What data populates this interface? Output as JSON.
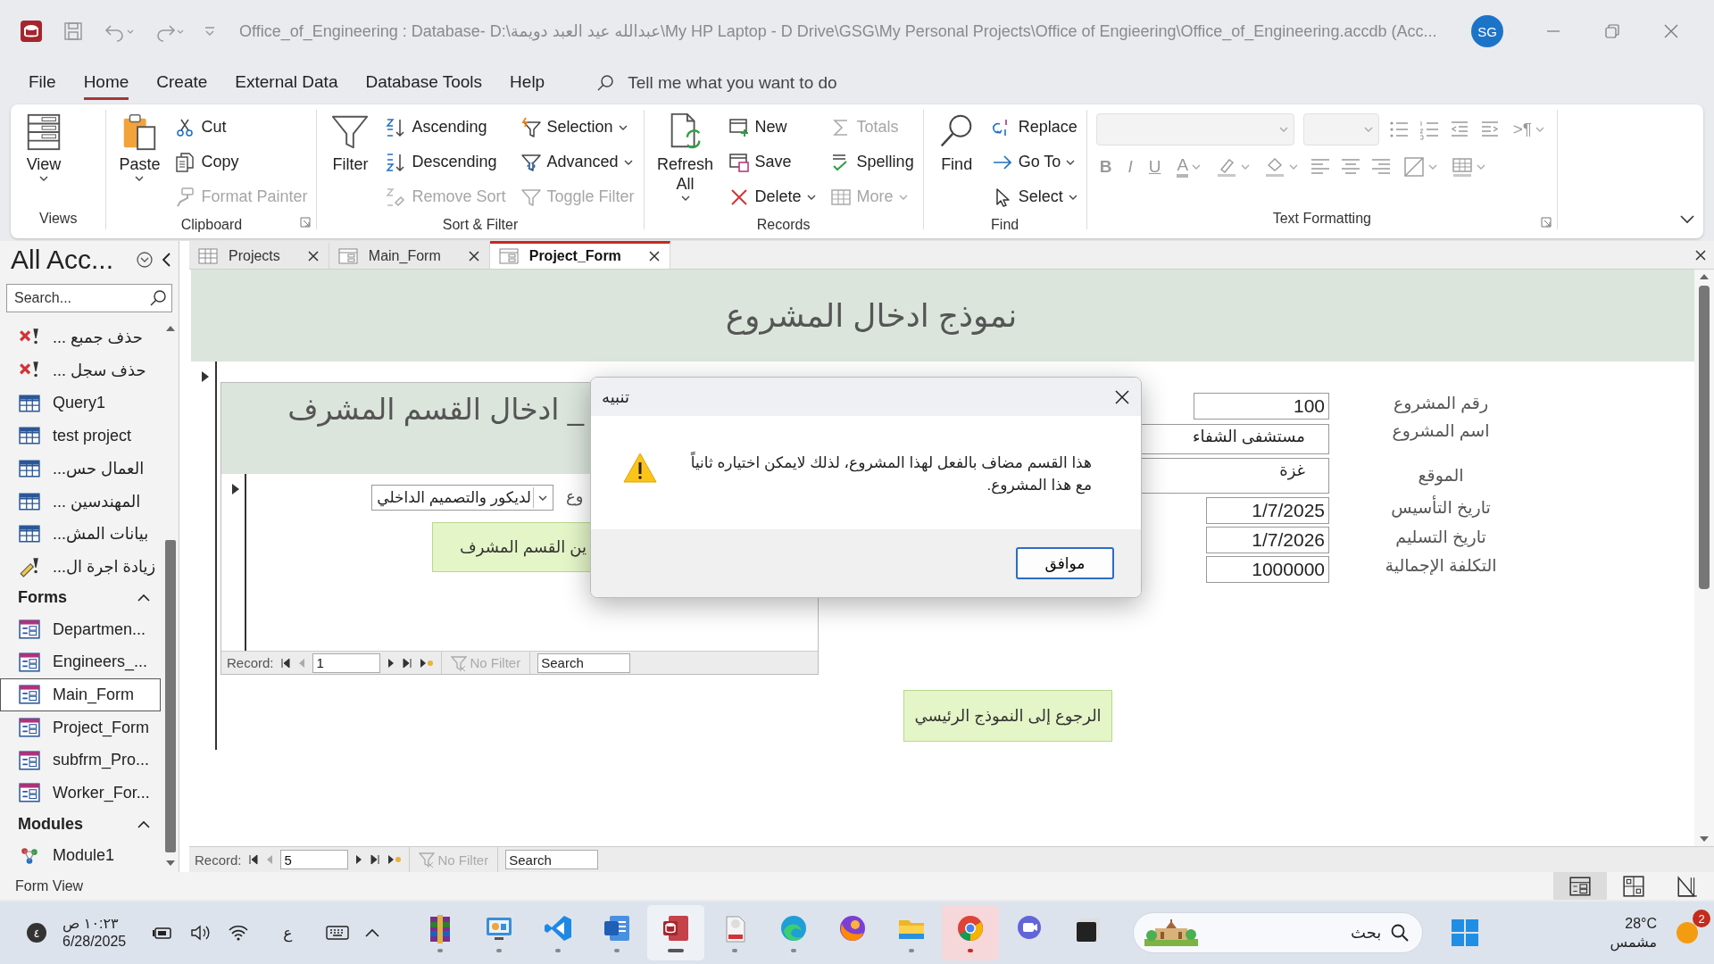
{
  "window": {
    "title": "Office_of_Engineering : Database- D:\\عبدالله عيد العبد دويمة\\My HP Laptop - D Drive\\GSG\\My Personal Projects\\Office of Engieering\\Office_of_Engineering.accdb (Acc...",
    "account": "SG"
  },
  "menu_tabs": [
    {
      "label": "File",
      "selected": false
    },
    {
      "label": "Home",
      "selected": true
    },
    {
      "label": "Create",
      "selected": false
    },
    {
      "label": "External Data",
      "selected": false
    },
    {
      "label": "Database Tools",
      "selected": false
    },
    {
      "label": "Help",
      "selected": false
    }
  ],
  "tell_me": {
    "placeholder": "Tell me what you want to do"
  },
  "ribbon_groups": [
    {
      "label": "Views",
      "kind": "buttons",
      "launcher": false,
      "items": [
        {
          "label": "View",
          "kind": "large",
          "disabled": false,
          "dropdown": true
        }
      ]
    },
    {
      "label": "Clipboard",
      "kind": "buttons",
      "launcher": true,
      "items": [
        {
          "label": "Paste",
          "kind": "large",
          "disabled": false,
          "dropdown": true
        },
        {
          "label": "Cut",
          "kind": "small",
          "disabled": false,
          "dropdown": false
        },
        {
          "label": "Copy",
          "kind": "small",
          "disabled": false,
          "dropdown": false
        },
        {
          "label": "Format Painter",
          "kind": "small",
          "disabled": true,
          "dropdown": false
        }
      ]
    },
    {
      "label": "Sort & Filter",
      "kind": "buttons",
      "launcher": false,
      "items": [
        {
          "label": "Filter",
          "kind": "large",
          "disabled": false,
          "dropdown": false
        },
        {
          "label": "Ascending",
          "kind": "small",
          "disabled": false,
          "dropdown": false
        },
        {
          "label": "Descending",
          "kind": "small",
          "disabled": false,
          "dropdown": false
        },
        {
          "label": "Remove Sort",
          "kind": "small",
          "disabled": true,
          "dropdown": false
        },
        {
          "label": "Selection",
          "kind": "small",
          "disabled": false,
          "dropdown": true
        },
        {
          "label": "Advanced",
          "kind": "small",
          "disabled": false,
          "dropdown": true
        },
        {
          "label": "Toggle Filter",
          "kind": "small",
          "disabled": true,
          "dropdown": false
        }
      ]
    },
    {
      "label": "Records",
      "kind": "buttons",
      "launcher": false,
      "items": [
        {
          "label": "Refresh All",
          "kind": "large",
          "disabled": false,
          "dropdown": true
        },
        {
          "label": "New",
          "kind": "small",
          "disabled": false,
          "dropdown": false
        },
        {
          "label": "Save",
          "kind": "small",
          "disabled": false,
          "dropdown": false
        },
        {
          "label": "Delete",
          "kind": "small",
          "disabled": false,
          "dropdown": true
        },
        {
          "label": "Totals",
          "kind": "small",
          "disabled": true,
          "dropdown": false
        },
        {
          "label": "Spelling",
          "kind": "small",
          "disabled": false,
          "dropdown": false
        },
        {
          "label": "More",
          "kind": "small",
          "disabled": true,
          "dropdown": true
        }
      ]
    },
    {
      "label": "Find",
      "kind": "buttons",
      "launcher": false,
      "items": [
        {
          "label": "Find",
          "kind": "large",
          "disabled": false,
          "dropdown": false
        },
        {
          "label": "Replace",
          "kind": "small",
          "disabled": false,
          "dropdown": false
        },
        {
          "label": "Go To",
          "kind": "small",
          "disabled": false,
          "dropdown": true
        },
        {
          "label": "Select",
          "kind": "small",
          "disabled": false,
          "dropdown": true
        }
      ]
    },
    {
      "label": "Text Formatting",
      "kind": "format",
      "launcher": true,
      "rows": [
        [
          {
            "kind": "combo",
            "disabled": true
          },
          {
            "kind": "combo",
            "disabled": true
          },
          {
            "kind": "icon",
            "disabled": true,
            "dropdown": false
          },
          {
            "kind": "icon",
            "disabled": true,
            "dropdown": false
          },
          {
            "kind": "icon",
            "disabled": true,
            "dropdown": false
          },
          {
            "kind": "icon",
            "disabled": true,
            "dropdown": false
          },
          {
            "kind": "glyph",
            "label": ">¶",
            "disabled": true,
            "dropdown": true
          }
        ],
        [
          {
            "kind": "glyph",
            "label": "B",
            "disabled": true,
            "dropdown": false
          },
          {
            "kind": "glyph",
            "label": "I",
            "disabled": true,
            "dropdown": false
          },
          {
            "kind": "glyph",
            "label": "U",
            "disabled": true,
            "dropdown": false
          },
          {
            "kind": "glyph",
            "label": "A",
            "disabled": true,
            "dropdown": true
          },
          {
            "kind": "icon",
            "disabled": true,
            "dropdown": true
          },
          {
            "kind": "icon",
            "disabled": true,
            "dropdown": true
          },
          {
            "kind": "icon",
            "disabled": true,
            "dropdown": false
          },
          {
            "kind": "icon",
            "disabled": true,
            "dropdown": false
          },
          {
            "kind": "icon",
            "disabled": true,
            "dropdown": false
          },
          {
            "kind": "icon",
            "disabled": true,
            "dropdown": true
          },
          {
            "kind": "icon",
            "disabled": true,
            "dropdown": true
          }
        ]
      ]
    }
  ],
  "nav_pane": {
    "title": "All Acc...",
    "search": {
      "placeholder": "Search..."
    },
    "groups": [
      {
        "items": [
          {
            "label": "حذف جمبع ...",
            "kind": "delete-query",
            "selected": false
          },
          {
            "label": "حذف سجل ...",
            "kind": "delete-query",
            "selected": false
          },
          {
            "label": "Query1",
            "kind": "select-query",
            "selected": false
          },
          {
            "label": "test project",
            "kind": "select-query",
            "selected": false
          },
          {
            "label": "العمال حس...",
            "kind": "select-query",
            "selected": false
          },
          {
            "label": "المهندسين ...",
            "kind": "select-query",
            "selected": false
          },
          {
            "label": "بيانات المش...",
            "kind": "select-query",
            "selected": false
          },
          {
            "label": "زيادة اجرة ال...",
            "kind": "update-query",
            "selected": false
          }
        ]
      },
      {
        "header": "Forms",
        "expanded": true,
        "items": [
          {
            "label": "Departmen...",
            "kind": "form",
            "selected": false
          },
          {
            "label": "Engineers_...",
            "kind": "form",
            "selected": false
          },
          {
            "label": "Main_Form",
            "kind": "form",
            "selected": true
          },
          {
            "label": "Project_Form",
            "kind": "form",
            "selected": false
          },
          {
            "label": "subfrm_Pro...",
            "kind": "form",
            "selected": false
          },
          {
            "label": "Worker_For...",
            "kind": "form",
            "selected": false
          }
        ]
      },
      {
        "header": "Modules",
        "expanded": true,
        "items": [
          {
            "label": "Module1",
            "kind": "module",
            "selected": false
          }
        ]
      }
    ]
  },
  "document_tabs": [
    {
      "label": "Projects",
      "kind": "table",
      "selected": false
    },
    {
      "label": "Main_Form",
      "kind": "form",
      "selected": false
    },
    {
      "label": "Project_Form",
      "kind": "form",
      "selected": true
    }
  ],
  "form": {
    "title": "نموذج ادخال المشروع",
    "subform": {
      "title": "_ ادخال القسم المشرف",
      "combo_label": "وع",
      "combo_value": "لديكور والتصميم الداخلي",
      "button": "ين القسم المشرف",
      "record_bar": {
        "label": "Record:",
        "current": "1",
        "filter": "No Filter",
        "placeholder": "Search"
      }
    },
    "fields": [
      {
        "label": "رقم المشروع",
        "value": "100"
      },
      {
        "label": "اسم المشروع",
        "value": "مستشفى الشفاء"
      },
      {
        "label": "الموقع",
        "value": "غزة"
      },
      {
        "label": "تاريخ التأسيس",
        "value": "1/7/2025"
      },
      {
        "label": "تاريخ التسليم",
        "value": "1/7/2026"
      },
      {
        "label": "التكلفة الإجمالية",
        "value": "1000000"
      }
    ],
    "back_button": "الرجوع إلى النموذج الرئيسي",
    "record_bar": {
      "label": "Record:",
      "current": "5",
      "filter": "No Filter",
      "placeholder": "Search"
    }
  },
  "dialog": {
    "title": "تنبيه",
    "message": "هذا القسم مضاف بالفعل لهذا المشروع، لذلك لايمكن اختياره ثانياً مع هذا المشروع.",
    "button": "موافق"
  },
  "status_bar": {
    "text": "Form View",
    "views": [
      {
        "selected": true
      },
      {
        "selected": false
      },
      {
        "selected": false
      }
    ]
  },
  "taskbar": {
    "notifications": "٤",
    "time": "١٠:٢٣ ص",
    "date": "6/28/2025",
    "language": "ع",
    "apps": [
      {
        "running": true,
        "active": false,
        "flagged": false
      },
      {
        "running": true,
        "active": false,
        "flagged": false
      },
      {
        "running": true,
        "active": false,
        "flagged": false
      },
      {
        "running": true,
        "active": false,
        "flagged": false
      },
      {
        "running": true,
        "active": true,
        "flagged": false
      },
      {
        "running": true,
        "active": false,
        "flagged": false
      },
      {
        "running": true,
        "active": false,
        "flagged": false
      },
      {
        "running": false,
        "active": false,
        "flagged": false
      },
      {
        "running": true,
        "active": false,
        "flagged": false
      },
      {
        "running": true,
        "active": false,
        "flagged": true
      },
      {
        "running": false,
        "active": false,
        "flagged": false
      },
      {
        "running": false,
        "active": false,
        "flagged": false
      }
    ],
    "search": {
      "placeholder": "بحث"
    },
    "weather": {
      "temperature": "28°C",
      "condition": "مشمس",
      "badge": "2"
    }
  }
}
